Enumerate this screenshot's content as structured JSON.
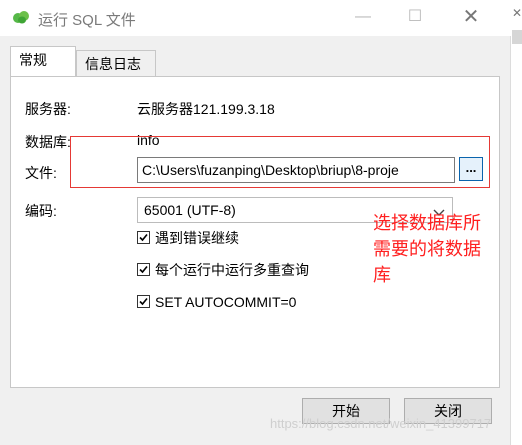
{
  "window": {
    "title": "运行 SQL 文件",
    "minimize_glyph": "—",
    "maximize_glyph": "☐",
    "close_glyph": "✕"
  },
  "tabs": [
    {
      "label": "常规",
      "active": true
    },
    {
      "label": "信息日志",
      "active": false
    }
  ],
  "form": {
    "server_label": "服务器:",
    "server_value": "云服务器121.199.3.18",
    "database_label": "数据库:",
    "database_value": "info",
    "file_label": "文件:",
    "file_value": "C:\\Users\\fuzanping\\Desktop\\briup\\8-proje",
    "browse_label": "...",
    "encoding_label": "编码:",
    "encoding_value": "65001 (UTF-8)"
  },
  "options": [
    {
      "label": "遇到错误继续",
      "checked": true
    },
    {
      "label": "每个运行中运行多重查询",
      "checked": true
    },
    {
      "label": "SET AUTOCOMMIT=0",
      "checked": true
    }
  ],
  "buttons": {
    "start": "开始",
    "close": "关闭"
  },
  "annotation": {
    "text": "选择数据库所需要的将数据库",
    "color": "#ff2020"
  },
  "watermark": "https://blog.csdn.net/weixin_41399717",
  "colors": {
    "dialog_bg": "#f0f0f0",
    "annotation_border": "#e53935",
    "browse_border": "#0a64ad",
    "app_icon": "#4caf50"
  }
}
